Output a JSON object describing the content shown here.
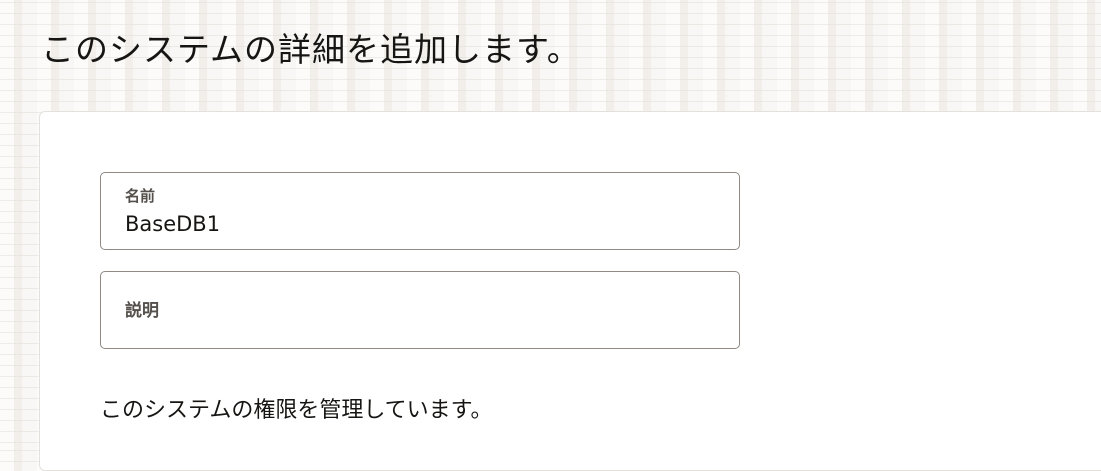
{
  "header": {
    "title": "このシステムの詳細を追加します。"
  },
  "form": {
    "name_field": {
      "label": "名前",
      "value": "BaseDB1"
    },
    "description_field": {
      "label": "説明",
      "value": ""
    },
    "permissions_text": "このシステムの権限を管理しています。"
  }
}
